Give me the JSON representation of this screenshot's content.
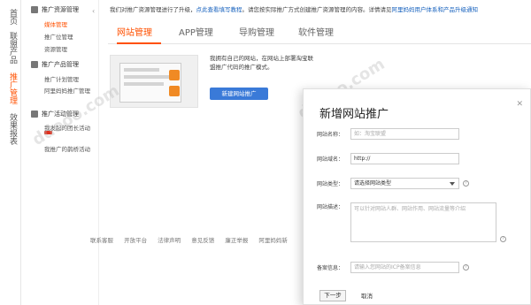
{
  "vnav": {
    "items": [
      {
        "label": "首页"
      },
      {
        "label": "联盟产品"
      },
      {
        "label": "推广管理"
      },
      {
        "label": "效果报表"
      }
    ]
  },
  "sidebar": {
    "collapse_icon": "chevron-left-icon",
    "groups": [
      {
        "label": "推广资源管理",
        "items": [
          "媒体管理",
          "推广位管理",
          "资源管理"
        ]
      },
      {
        "label": "推广产品管理",
        "items": [
          "推广计划管理",
          "阿里妈妈推广管理"
        ]
      },
      {
        "label": "推广活动管理",
        "items": [
          "我发起的团长活动",
          "我推广的鹊桥活动"
        ]
      }
    ]
  },
  "notice": {
    "prefix": "我们对推广资源管理进行了升级，",
    "link1": "点此查看填写教程",
    "middle": "。请您按实际推广方式创建推广资源管理的内容。详情请见",
    "link2": "阿里妈妈用户体系和产品升级通知"
  },
  "tabs": [
    {
      "label": "网站管理"
    },
    {
      "label": "APP管理"
    },
    {
      "label": "导购管理"
    },
    {
      "label": "软件管理"
    }
  ],
  "promo": {
    "text": "我拥有自己的网站，在网站上部署淘宝联盟推广代码的推广模式。",
    "button": "新建网站推广"
  },
  "footer": {
    "links": [
      "联系客服",
      "开放平台",
      "法律声明",
      "意见反馈",
      "廉正举报",
      "阿里妈妈新"
    ]
  },
  "modal": {
    "title": "新增网站推广",
    "fields": {
      "name": {
        "label": "网站名称：",
        "placeholder": "如：淘宝联盟"
      },
      "domain": {
        "label": "网站域名：",
        "value": "http://"
      },
      "type": {
        "label": "网站类型：",
        "value": "请选择网站类型"
      },
      "desc": {
        "label": "网站描述：",
        "placeholder": "可以针对网站人群、网站作用、网站流量等介绍"
      },
      "icp": {
        "label": "备案信息：",
        "placeholder": "请输入您网站的ICP备案信息"
      }
    },
    "next_button": "下一步",
    "cancel": "取消"
  },
  "watermark": "ddooo.com"
}
